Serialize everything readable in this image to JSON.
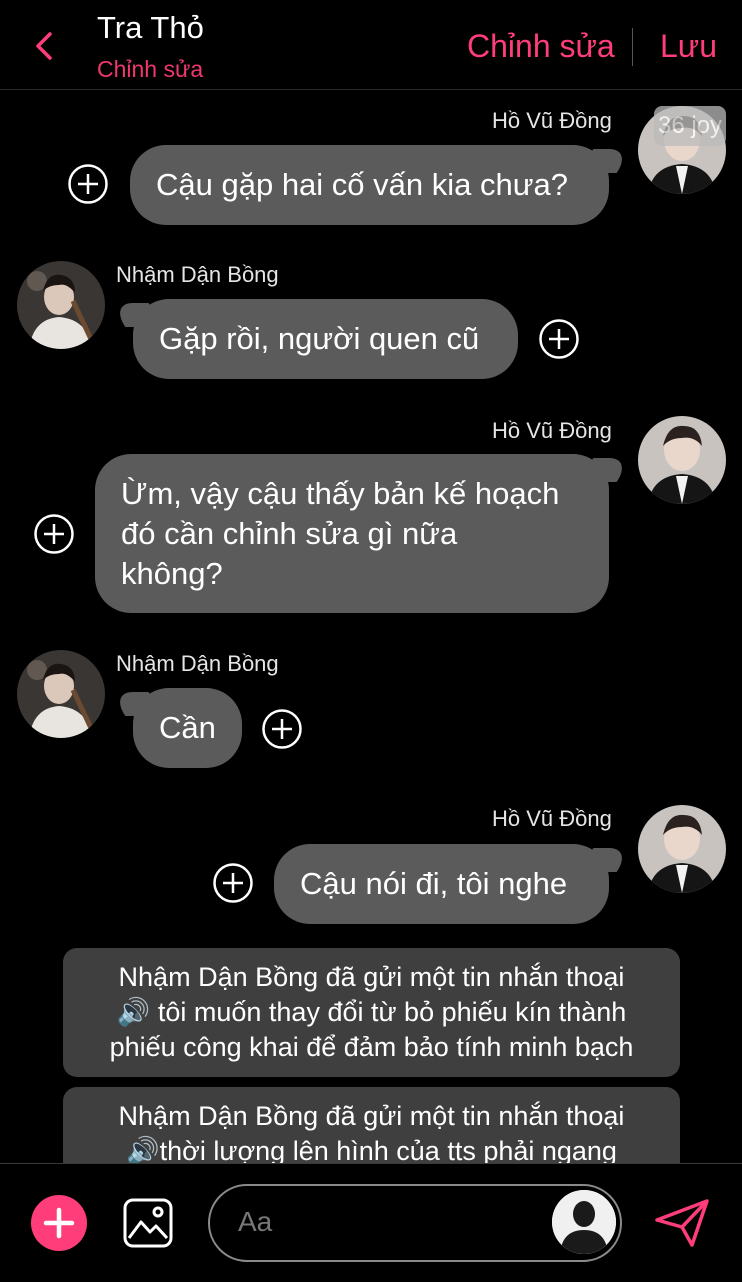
{
  "header": {
    "title": "Tra Thỏ",
    "subtitle": "Chỉnh sửa",
    "edit_label": "Chỉnh sửa",
    "save_label": "Lưu"
  },
  "watermark": "36 joy",
  "messages": [
    {
      "sender": "Hồ Vũ Đồng",
      "side": "right",
      "text": "Cậu gặp hai cố vấn kia chưa?"
    },
    {
      "sender": "Nhậm Dận Bồng",
      "side": "left",
      "text": "Gặp rồi, người quen cũ"
    },
    {
      "sender": "Hồ Vũ Đồng",
      "side": "right",
      "lines": [
        "Ừm, vậy cậu thấy bản kế hoạch",
        "đó cần chỉnh sửa gì nữa",
        "không?"
      ]
    },
    {
      "sender": "Nhậm Dận Bồng",
      "side": "left",
      "text": "Cần"
    },
    {
      "sender": "Hồ Vũ Đồng",
      "side": "right",
      "text": "Cậu nói đi, tôi nghe"
    }
  ],
  "system_messages": [
    {
      "lines": [
        "Nhậm Dận Bồng đã gửi một tin nhắn thoại",
        "🔊 tôi muốn thay đổi từ bỏ phiếu kín thành",
        "phiếu công khai để đảm bảo tính minh bạch"
      ]
    },
    {
      "lines": [
        "Nhậm Dận Bồng đã gửi một tin nhắn thoại",
        "🔊thời lượng lên hình của tts phải ngang"
      ]
    }
  ],
  "composer": {
    "placeholder": "Aa"
  },
  "colors": {
    "accent": "#ff3d7a",
    "bubble": "#5b5b5b",
    "system_bubble": "#3f3f3f",
    "background": "#000000"
  }
}
